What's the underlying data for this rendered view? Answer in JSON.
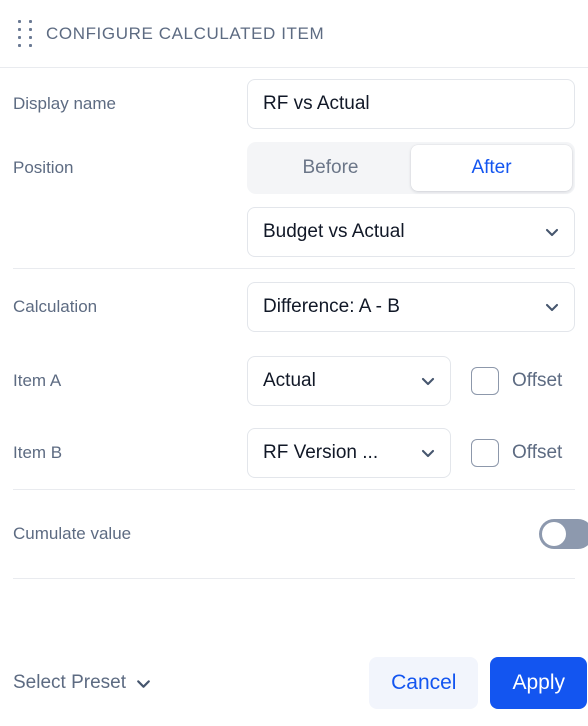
{
  "header": {
    "title": "CONFIGURE CALCULATED ITEM",
    "drag_handle_icon": "drag-dots-icon"
  },
  "form": {
    "display_name": {
      "label": "Display name",
      "value": "RF vs Actual",
      "placeholder": "Display name"
    },
    "position": {
      "label": "Position",
      "options": [
        "Before",
        "After"
      ],
      "selected": "After"
    },
    "scenario": {
      "value": "Budget vs Actual",
      "chevron_icon": "chevron-down-icon"
    },
    "calculation": {
      "label": "Calculation",
      "value": "Difference: A - B",
      "chevron_icon": "chevron-down-icon"
    },
    "item_a": {
      "label": "Item A",
      "value": "Actual",
      "chevron_icon": "chevron-down-icon",
      "offset_label": "Offset",
      "offset_checked": false
    },
    "item_b": {
      "label": "Item B",
      "value": "RF Version ...",
      "chevron_icon": "chevron-down-icon",
      "offset_label": "Offset",
      "offset_checked": false
    },
    "cumulate": {
      "label": "Cumulate value",
      "enabled": false
    }
  },
  "footer": {
    "preset_label": "Select Preset",
    "preset_chevron_icon": "chevron-down-icon",
    "cancel_label": "Cancel",
    "apply_label": "Apply"
  },
  "colors": {
    "accent_blue": "#1355f0",
    "label_slate": "#5d6b82",
    "value_text": "#111827",
    "border": "#e3e6eb",
    "divider": "#e9ebef",
    "segment_track": "#f4f5f7",
    "toggle_off_track": "#8d99ae",
    "cancel_bg": "#f2f5fc"
  }
}
